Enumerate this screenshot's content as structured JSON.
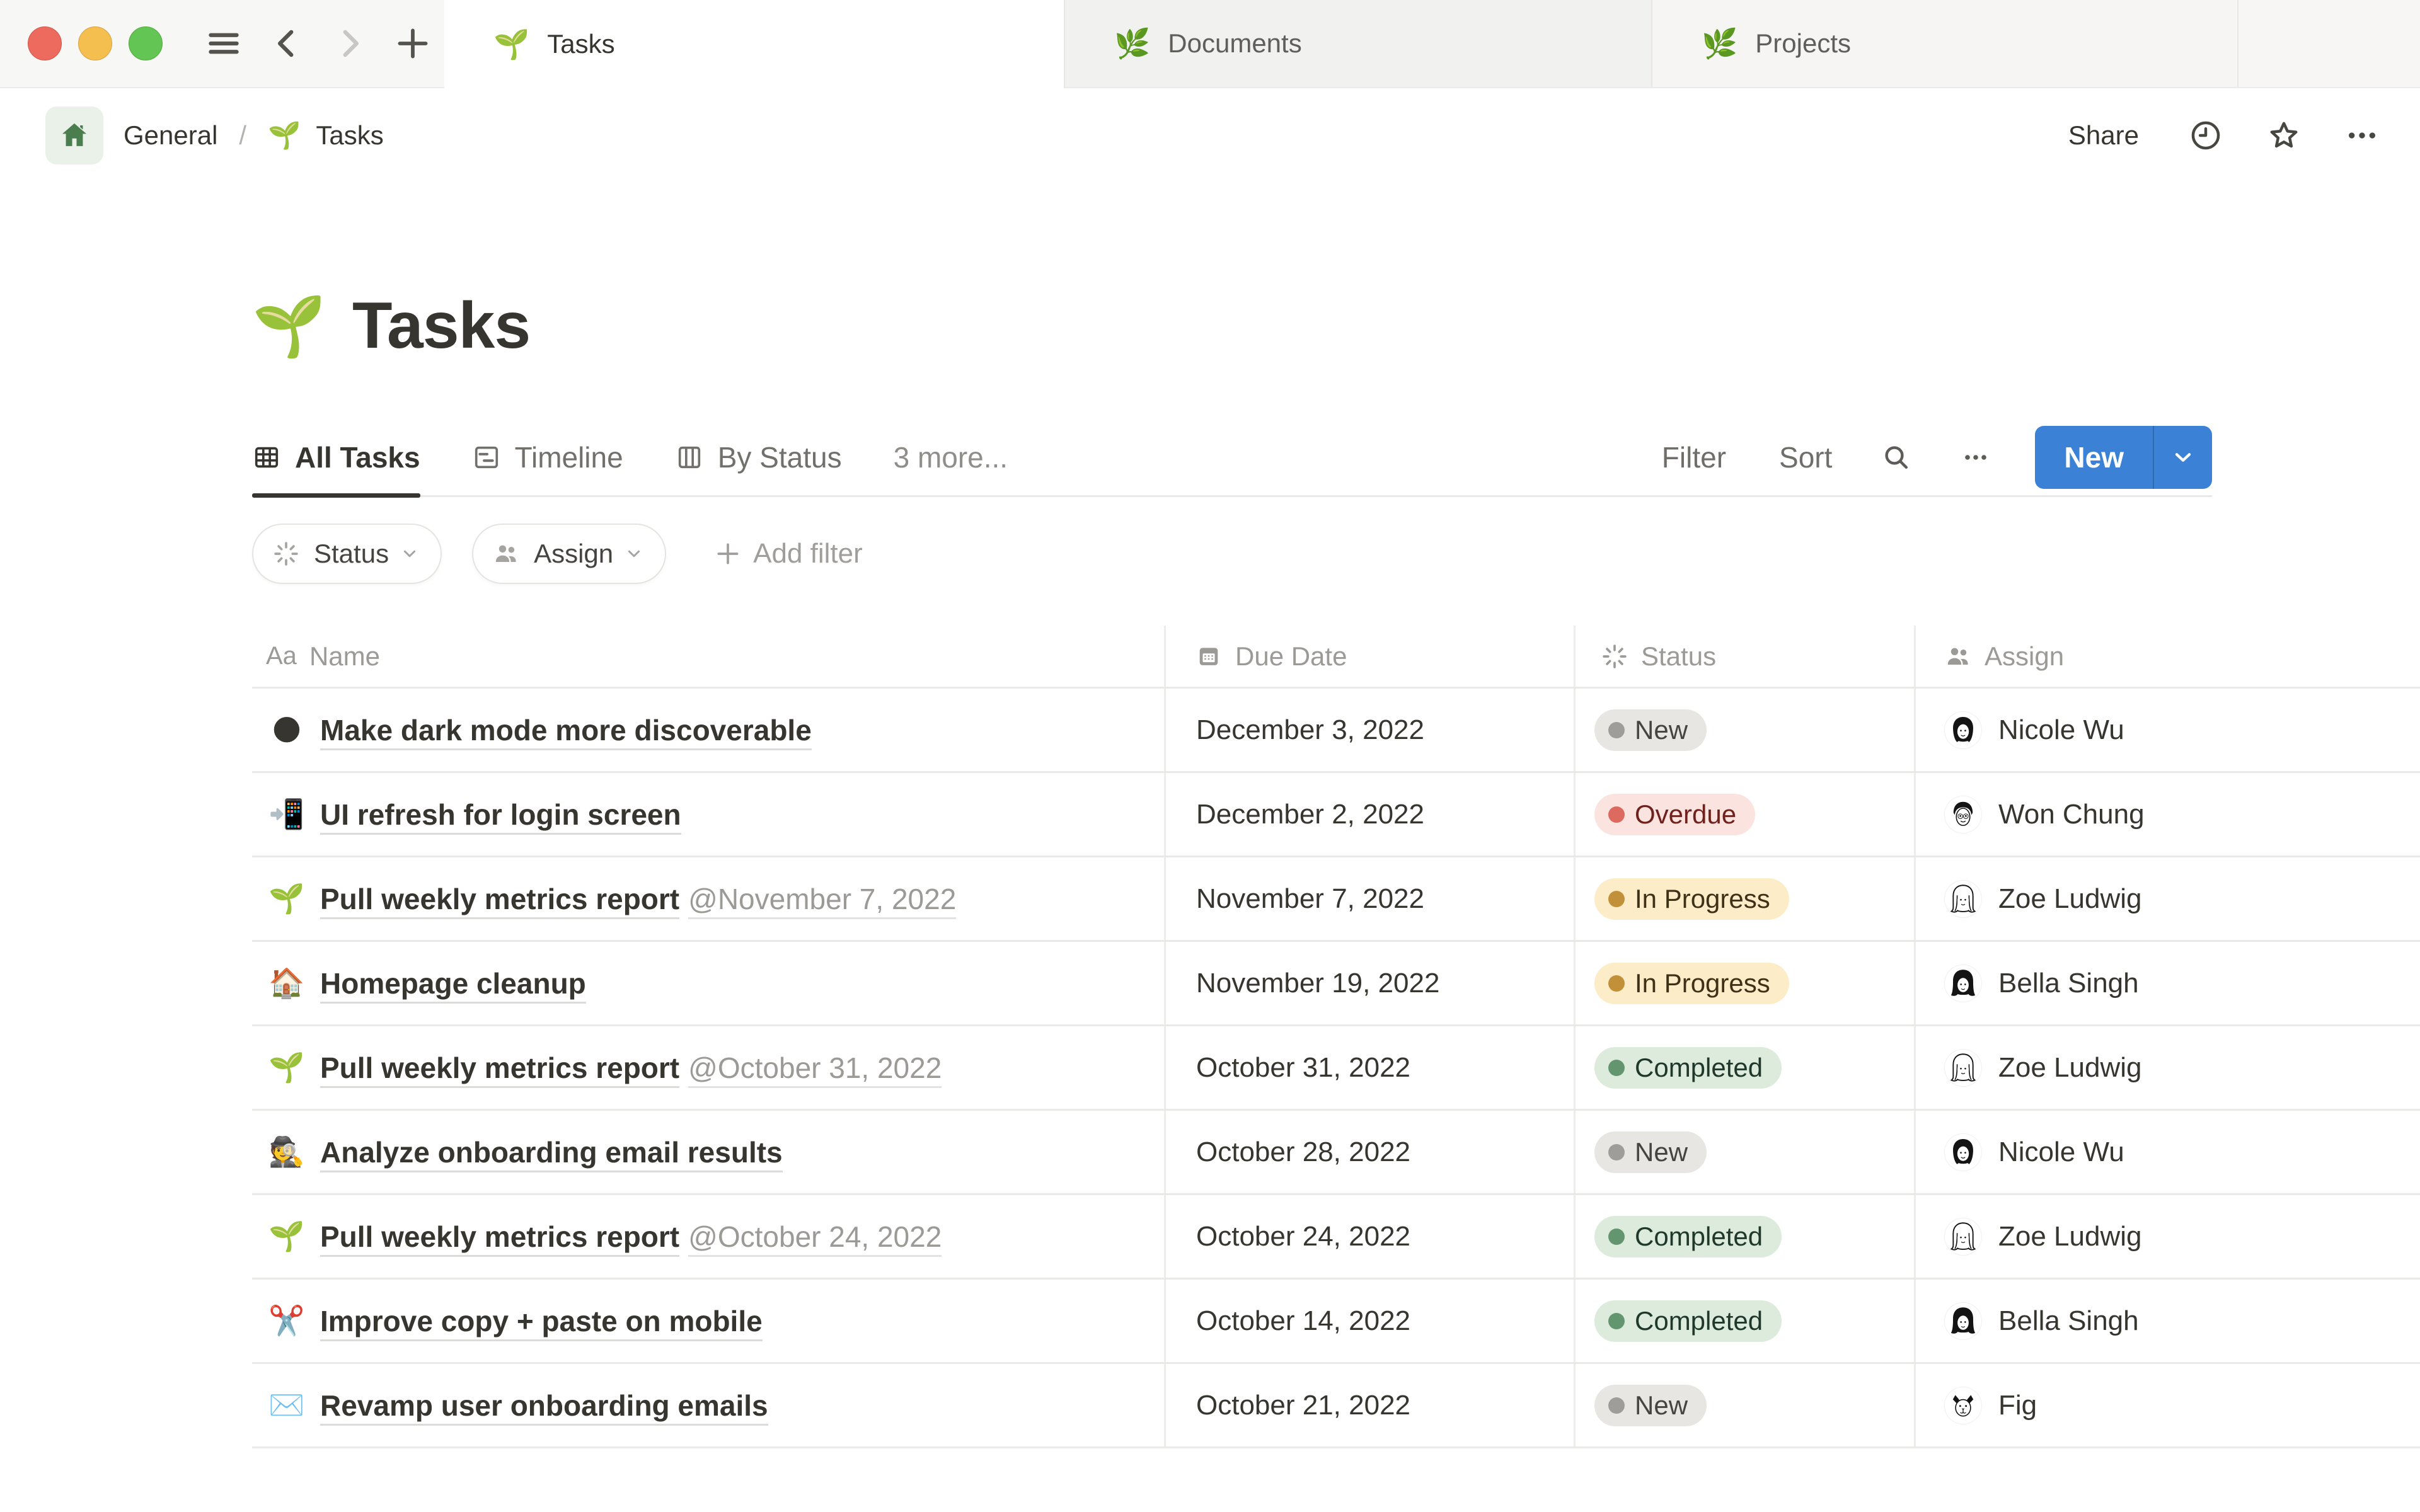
{
  "window": {
    "tabs": [
      {
        "icon": "🌱",
        "label": "Tasks",
        "active": true
      },
      {
        "icon": "🌿",
        "label": "Documents",
        "active": false
      },
      {
        "icon": "🌿",
        "label": "Projects",
        "active": false
      }
    ]
  },
  "breadcrumb": {
    "home_icon": "home-icon",
    "workspace": "General",
    "separator": "/",
    "page_icon": "🌱",
    "page_title": "Tasks"
  },
  "topbar": {
    "share_label": "Share"
  },
  "page": {
    "icon": "🌱",
    "title": "Tasks"
  },
  "views": {
    "tabs": [
      {
        "icon": "table-icon",
        "label": "All Tasks",
        "active": true
      },
      {
        "icon": "timeline-icon",
        "label": "Timeline",
        "active": false
      },
      {
        "icon": "board-icon",
        "label": "By Status",
        "active": false
      }
    ],
    "more_label": "3 more...",
    "toolbar": {
      "filter": "Filter",
      "sort": "Sort",
      "new": "New"
    }
  },
  "filters": {
    "chips": [
      {
        "icon": "status-burst-icon",
        "label": "Status"
      },
      {
        "icon": "people-icon",
        "label": "Assign"
      }
    ],
    "add_filter_label": "Add filter"
  },
  "table": {
    "columns": [
      {
        "icon": "Aa",
        "label": "Name"
      },
      {
        "icon": "calendar-icon",
        "label": "Due Date"
      },
      {
        "icon": "status-burst-icon",
        "label": "Status"
      },
      {
        "icon": "people-icon",
        "label": "Assign"
      }
    ],
    "rows": [
      {
        "icon": "🌑",
        "name": "Make dark mode more discoverable",
        "name_suffix": "",
        "due": "December 3, 2022",
        "status": "New",
        "status_color": "gray",
        "assignee": "Nicole Wu",
        "avatar": "woman-bob"
      },
      {
        "icon": "📲",
        "name": "UI refresh for login screen",
        "name_suffix": "",
        "due": "December 2, 2022",
        "status": "Overdue",
        "status_color": "red",
        "assignee": "Won Chung",
        "avatar": "man-short"
      },
      {
        "icon": "🌱",
        "name": "Pull weekly metrics report",
        "name_suffix": "@November 7, 2022",
        "due": "November 7, 2022",
        "status": "In Progress",
        "status_color": "yellow",
        "assignee": "Zoe Ludwig",
        "avatar": "woman-long"
      },
      {
        "icon": "🏠",
        "name": "Homepage cleanup",
        "name_suffix": "",
        "due": "November 19, 2022",
        "status": "In Progress",
        "status_color": "yellow",
        "assignee": "Bella Singh",
        "avatar": "woman-wavy"
      },
      {
        "icon": "🌱",
        "name": "Pull weekly metrics report",
        "name_suffix": "@October 31, 2022",
        "due": "October 31, 2022",
        "status": "Completed",
        "status_color": "green",
        "assignee": "Zoe Ludwig",
        "avatar": "woman-long"
      },
      {
        "icon": "🕵️",
        "name": "Analyze onboarding email results",
        "name_suffix": "",
        "due": "October 28, 2022",
        "status": "New",
        "status_color": "gray",
        "assignee": "Nicole Wu",
        "avatar": "woman-bob"
      },
      {
        "icon": "🌱",
        "name": "Pull weekly metrics report",
        "name_suffix": "@October 24, 2022",
        "due": "October 24, 2022",
        "status": "Completed",
        "status_color": "green",
        "assignee": "Zoe Ludwig",
        "avatar": "woman-long"
      },
      {
        "icon": "✂️",
        "name": "Improve copy + paste on mobile",
        "name_suffix": "",
        "due": "October 14, 2022",
        "status": "Completed",
        "status_color": "green",
        "assignee": "Bella Singh",
        "avatar": "woman-wavy"
      },
      {
        "icon": "✉️",
        "name": "Revamp user onboarding emails",
        "name_suffix": "",
        "due": "October 21, 2022",
        "status": "New",
        "status_color": "gray",
        "assignee": "Fig",
        "avatar": "dog"
      }
    ]
  },
  "colors": {
    "accent_blue": "#3b82d6",
    "badge_gray_bg": "#e7e6e3",
    "badge_red_bg": "#fbe3e0",
    "badge_yellow_bg": "#fcecc7",
    "badge_green_bg": "#dcebdc",
    "dot_gray": "#9e9d99",
    "dot_red": "#dd6a5f",
    "dot_yellow": "#c3903a",
    "dot_green": "#63956f",
    "traffic_red": "#ec6a5e",
    "traffic_yellow": "#f5bf4f",
    "traffic_green": "#62c554"
  }
}
